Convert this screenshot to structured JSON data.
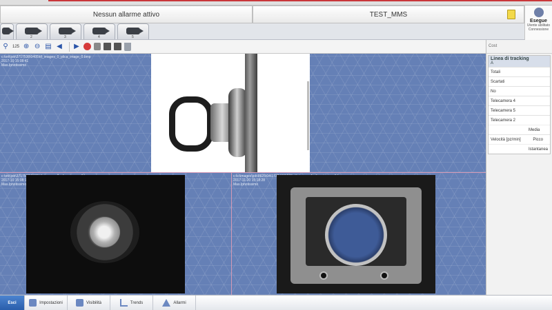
{
  "status_bar": {
    "alarm_text": "Nessun allarme attivo",
    "project_name": "TEST_MMS"
  },
  "user": {
    "name": "Esegue",
    "role": "Utente abilitato Connessione"
  },
  "camera_tabs": [
    {
      "num": "1"
    },
    {
      "num": "2"
    },
    {
      "num": "3"
    },
    {
      "num": "4"
    },
    {
      "num": "5"
    }
  ],
  "toolbar": {
    "zoom_level": "125"
  },
  "panes": {
    "top": {
      "path": "c:\\ork\\job\\3717536\\0405\\tif_images_0_plica_image_0.bmp",
      "time": "2017-10 15:08:41",
      "status": "Mas.Ipnotissimo"
    },
    "bottom_left": {
      "path": "c:\\ork\\job\\3717536\\0405\\tif_images_0_plica_image_0.bmp",
      "time": "2017-10 15:08:18",
      "status": "Mas.Ipnotissimo"
    },
    "bottom_right": {
      "path": "c:\\ic\\images\\job\\8625\\04\\1730\\966\\200_tif_image_4_plica_image_0.bmp",
      "time": "2017-11-20 15:18:28",
      "status": "Mas.Ipnotissimo"
    }
  },
  "right_panel": {
    "header": "Cost",
    "card_title": "Linea di tracking",
    "card_subtitle": "A",
    "rows": [
      {
        "label": "Totali",
        "value": ""
      },
      {
        "label": "Scartati",
        "value": ""
      },
      {
        "label": "No",
        "value": ""
      },
      {
        "label": "Telecamera 4",
        "value": ""
      },
      {
        "label": "Telecamera 5",
        "value": ""
      },
      {
        "label": "Telecamera 2",
        "value": ""
      }
    ],
    "speed_label": "Velocità [pz/min]",
    "speed_rows": [
      "Media",
      "Picco",
      "Istantanea"
    ]
  },
  "bottom_bar": {
    "buttons": [
      {
        "label": "Esci"
      },
      {
        "label": "Impostazioni"
      },
      {
        "label": "Visibilità"
      },
      {
        "label": "Trends"
      },
      {
        "label": "Allarmi"
      }
    ]
  },
  "colors": {
    "accent": "#2a5eab",
    "pane_background": "#6580b6",
    "alarm_red": "#d63b3b"
  }
}
